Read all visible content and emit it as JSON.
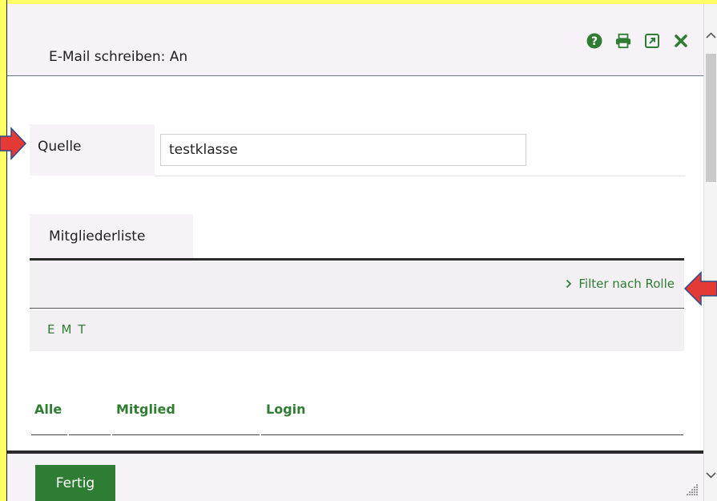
{
  "dialog": {
    "title": "E-Mail schreiben: An"
  },
  "header_icons": [
    "help-icon",
    "print-icon",
    "open-external-icon",
    "close-icon"
  ],
  "source": {
    "label": "Quelle",
    "value": "testklasse"
  },
  "tab": {
    "label": "Mitgliederliste"
  },
  "filter": {
    "label": "Filter nach Rolle"
  },
  "letters": [
    "E",
    "M",
    "T"
  ],
  "table": {
    "columns": [
      "Alle",
      "Mitglied",
      "Login"
    ]
  },
  "footer": {
    "done_label": "Fertig"
  },
  "colors": {
    "accent": "#2e7d32",
    "header_bg": "#f7f2f7",
    "annotation_arrow": "#e53935",
    "frame_highlight": "#ffff66"
  }
}
